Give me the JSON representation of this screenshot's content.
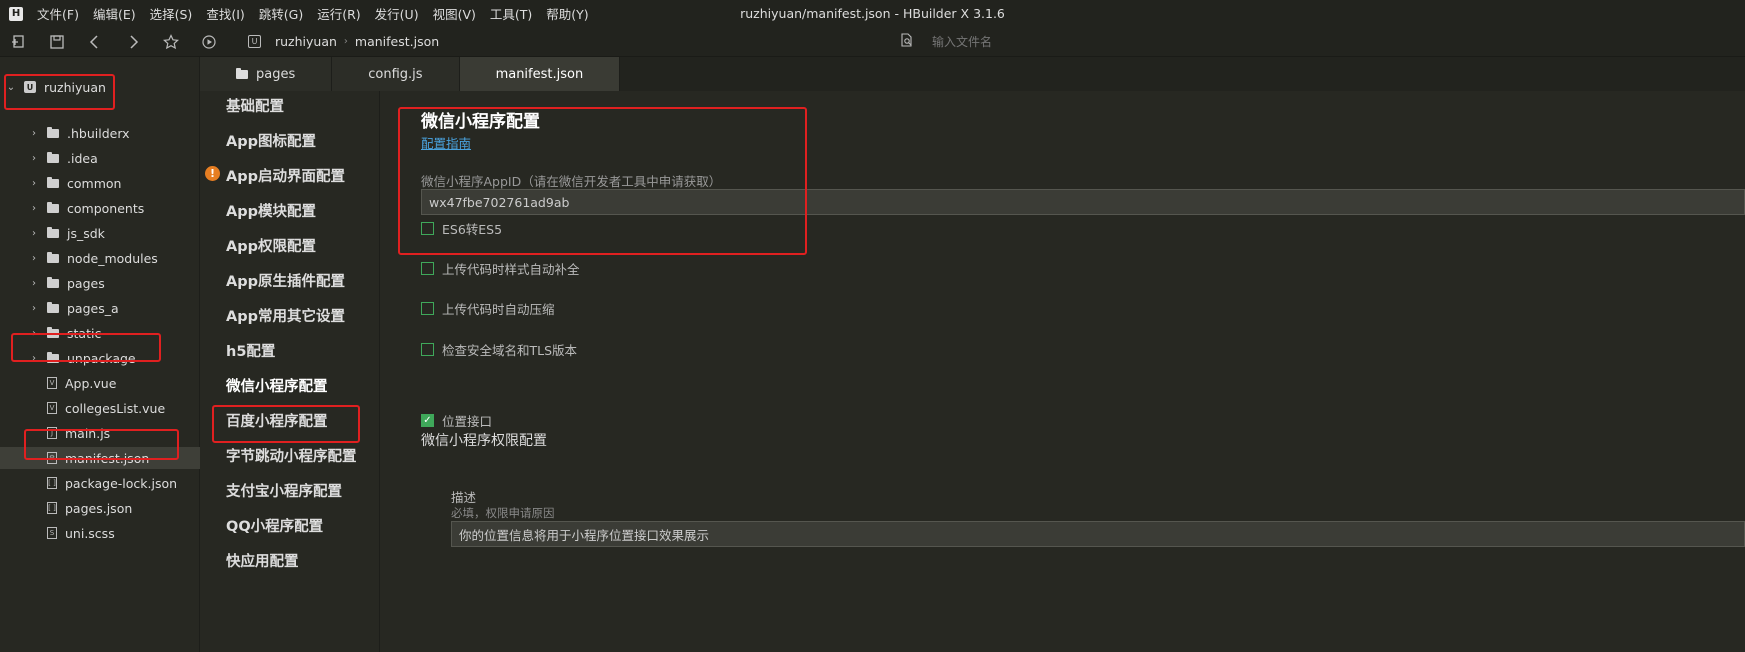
{
  "app": {
    "logo": "H",
    "title": "ruzhiyuan/manifest.json - HBuilder X 3.1.6"
  },
  "menu": [
    "文件(F)",
    "编辑(E)",
    "选择(S)",
    "查找(I)",
    "跳转(G)",
    "运行(R)",
    "发行(U)",
    "视图(V)",
    "工具(T)",
    "帮助(Y)"
  ],
  "toolbar": {
    "icons": [
      "new-file-icon",
      "save-icon",
      "back-icon",
      "forward-icon",
      "star-icon",
      "run-icon"
    ],
    "breadcrumb": [
      "ruzhiyuan",
      "manifest.json"
    ],
    "search_placeholder": "输入文件名"
  },
  "sidebar": {
    "project": "ruzhiyuan",
    "items": [
      {
        "label": ".hbuilderx",
        "type": "folder"
      },
      {
        "label": ".idea",
        "type": "folder"
      },
      {
        "label": "common",
        "type": "folder"
      },
      {
        "label": "components",
        "type": "folder"
      },
      {
        "label": "js_sdk",
        "type": "folder"
      },
      {
        "label": "node_modules",
        "type": "folder"
      },
      {
        "label": "pages",
        "type": "folder"
      },
      {
        "label": "pages_a",
        "type": "folder"
      },
      {
        "label": "static",
        "type": "folder"
      },
      {
        "label": "unpackage",
        "type": "folder"
      },
      {
        "label": "App.vue",
        "type": "vue"
      },
      {
        "label": "collegesList.vue",
        "type": "vue"
      },
      {
        "label": "main.js",
        "type": "js"
      },
      {
        "label": "manifest.json",
        "type": "json-settings",
        "active": true
      },
      {
        "label": "package-lock.json",
        "type": "json"
      },
      {
        "label": "pages.json",
        "type": "json"
      },
      {
        "label": "uni.scss",
        "type": "scss"
      }
    ]
  },
  "tabs": [
    {
      "label": "pages",
      "folder": true
    },
    {
      "label": "config.js"
    },
    {
      "label": "manifest.json",
      "active": true
    }
  ],
  "nav": [
    "基础配置",
    "App图标配置",
    "App启动界面配置",
    "App模块配置",
    "App权限配置",
    "App原生插件配置",
    "App常用其它设置",
    "h5配置",
    "微信小程序配置",
    "百度小程序配置",
    "字节跳动小程序配置",
    "支付宝小程序配置",
    "QQ小程序配置",
    "快应用配置"
  ],
  "nav_warning": "!",
  "content": {
    "title": "微信小程序配置",
    "guide_link": "配置指南",
    "appid_label": "微信小程序AppID（请在微信开发者工具中申请获取）",
    "appid_value": "wx47fbe702761ad9ab",
    "checkboxes": [
      {
        "label": "ES6转ES5",
        "checked": false
      },
      {
        "label": "上传代码时样式自动补全",
        "checked": false
      },
      {
        "label": "上传代码时自动压缩",
        "checked": false
      },
      {
        "label": "检查安全域名和TLS版本",
        "checked": false
      }
    ],
    "perm_section": "微信小程序权限配置",
    "location": {
      "label": "位置接口",
      "checked": true,
      "check_mark": "✓"
    },
    "desc_label": "描述",
    "desc_hint": "必填，权限申请原因",
    "desc_value": "你的位置信息将用于小程序位置接口效果展示"
  },
  "colors": {
    "highlight": "#e02020",
    "link": "#4aa3df",
    "check": "#3fa85a",
    "warning": "#e67e22"
  }
}
